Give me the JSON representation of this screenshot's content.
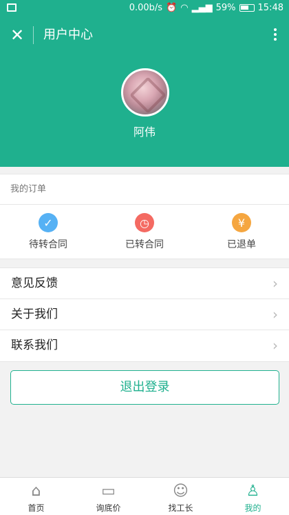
{
  "status_bar": {
    "network_speed": "0.00b/s",
    "battery_percent": "59%",
    "time": "15:48"
  },
  "header": {
    "title": "用户中心",
    "username": "阿伟"
  },
  "orders": {
    "section_title": "我的订单",
    "items": [
      {
        "label": "待转合同",
        "icon": "check-icon",
        "color": "#56b1f4"
      },
      {
        "label": "已转合同",
        "icon": "clock-icon",
        "color": "#f46a62"
      },
      {
        "label": "已退单",
        "icon": "refund-icon",
        "color": "#f5a640"
      }
    ]
  },
  "menu": {
    "items": [
      {
        "label": "意见反馈"
      },
      {
        "label": "关于我们"
      },
      {
        "label": "联系我们"
      }
    ]
  },
  "logout_label": "退出登录",
  "tabbar": {
    "tabs": [
      {
        "label": "首页",
        "icon": "home-icon",
        "active": false
      },
      {
        "label": "询底价",
        "icon": "price-icon",
        "active": false
      },
      {
        "label": "找工长",
        "icon": "worker-icon",
        "active": false
      },
      {
        "label": "我的",
        "icon": "profile-icon",
        "active": true
      }
    ]
  },
  "colors": {
    "primary": "#1fb08e"
  }
}
